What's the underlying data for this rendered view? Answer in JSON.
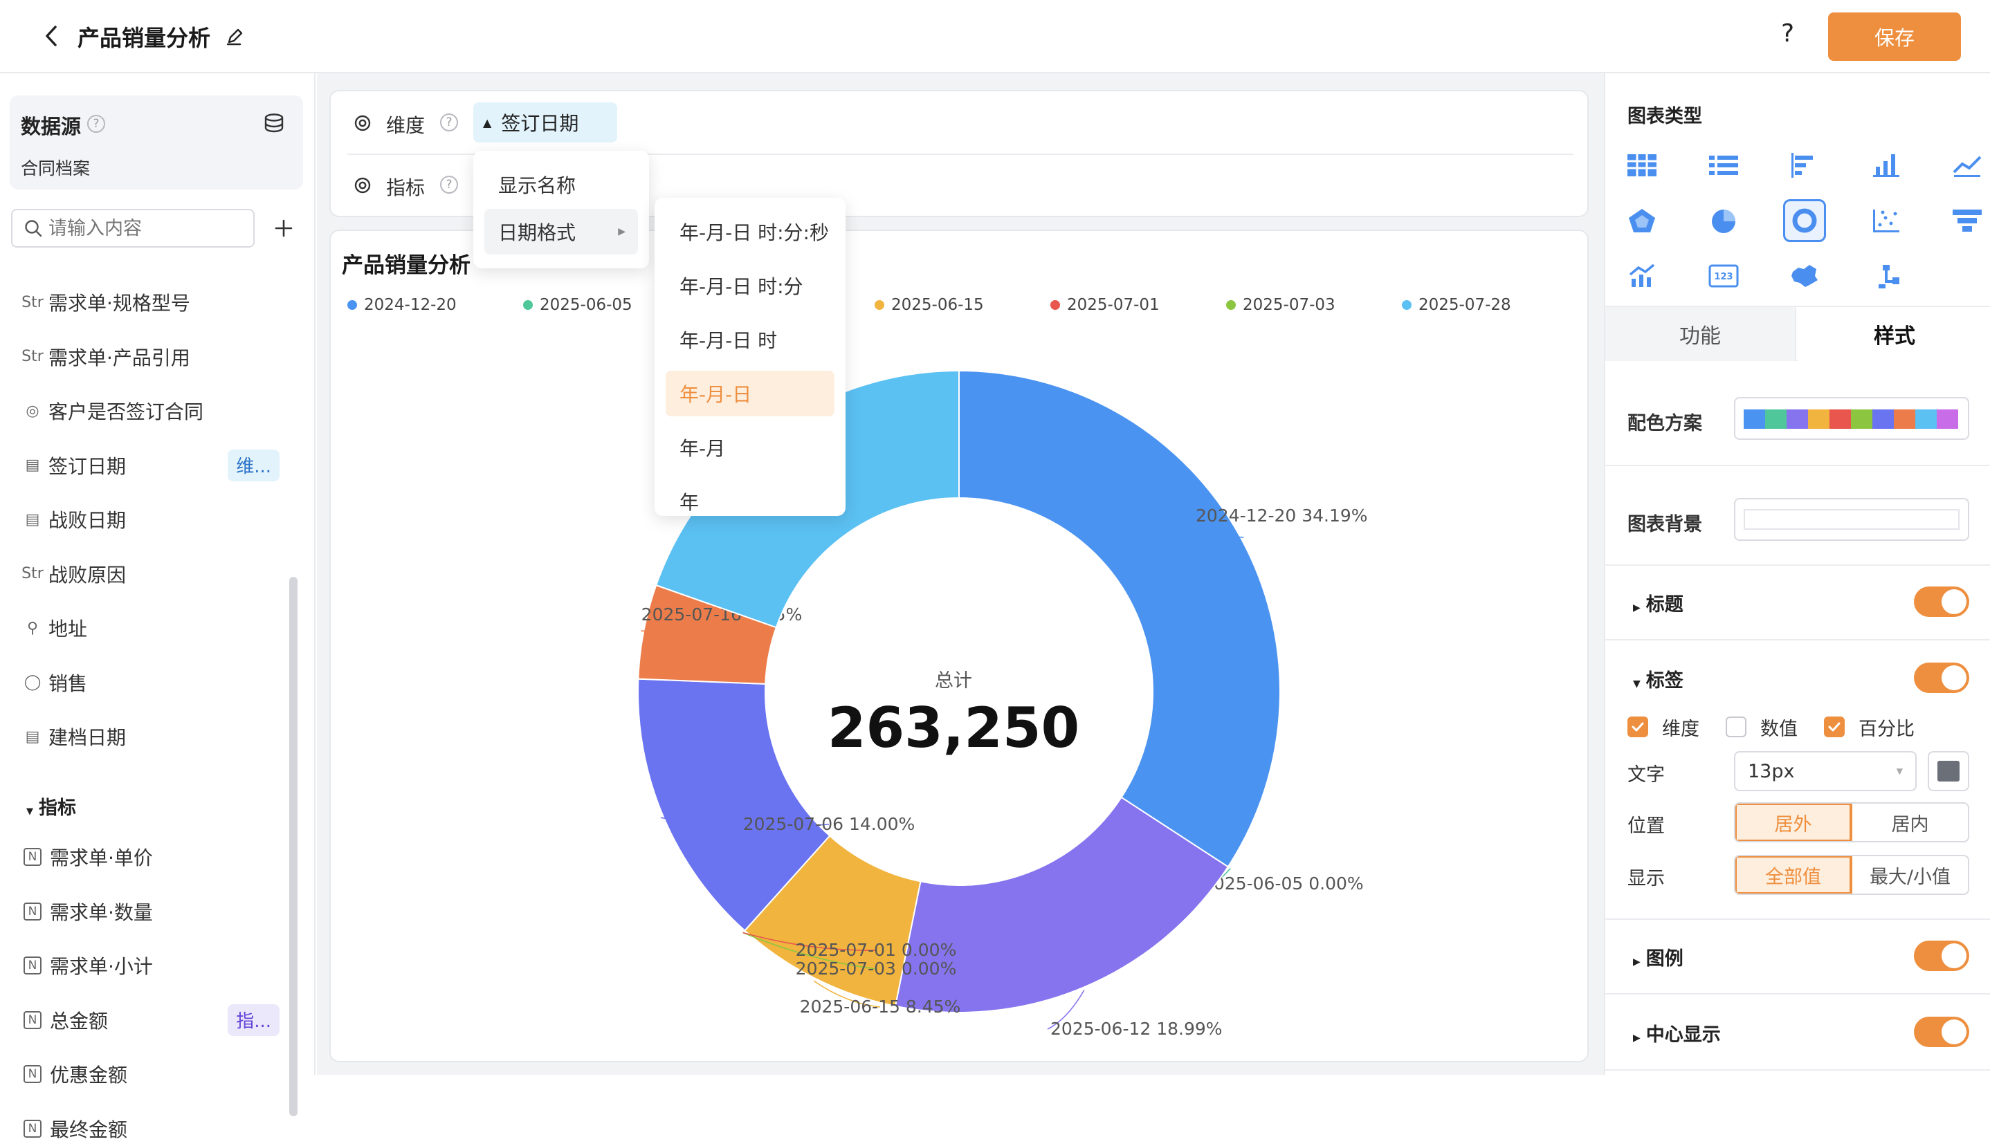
{
  "header": {
    "title": "产品销量分析",
    "help_label": "?",
    "save_label": "保存"
  },
  "datasource": {
    "label": "数据源",
    "name": "合同档案",
    "search_placeholder": "请输入内容",
    "fields": [
      {
        "icon": "Str",
        "label": "需求单·规格型号",
        "badge": ""
      },
      {
        "icon": "Str",
        "label": "需求单·产品引用",
        "badge": ""
      },
      {
        "icon": "◎",
        "label": "客户是否签订合同",
        "badge": ""
      },
      {
        "icon": "▤",
        "label": "签订日期",
        "badge": "维..."
      },
      {
        "icon": "▤",
        "label": "战败日期",
        "badge": ""
      },
      {
        "icon": "Str",
        "label": "战败原因",
        "badge": ""
      },
      {
        "icon": "⚲",
        "label": "地址",
        "badge": ""
      },
      {
        "icon": "◯",
        "label": "销售",
        "badge": ""
      },
      {
        "icon": "▤",
        "label": "建档日期",
        "badge": ""
      }
    ],
    "metrics_group_label": "指标",
    "metrics": [
      {
        "icon": "N",
        "label": "需求单·单价",
        "badge": ""
      },
      {
        "icon": "N",
        "label": "需求单·数量",
        "badge": ""
      },
      {
        "icon": "N",
        "label": "需求单·小计",
        "badge": ""
      },
      {
        "icon": "N",
        "label": "总金额",
        "badge": "指..."
      },
      {
        "icon": "N",
        "label": "优惠金额",
        "badge": ""
      },
      {
        "icon": "N",
        "label": "最终金额",
        "badge": ""
      }
    ]
  },
  "config": {
    "dimension_label": "维度",
    "dimension_chip": "签订日期",
    "metric_label": "指标"
  },
  "dropdown": {
    "items": [
      "显示名称",
      "日期格式"
    ],
    "submenu": [
      "年-月-日 时:分:秒",
      "年-月-日 时:分",
      "年-月-日 时",
      "年-月-日",
      "年-月",
      "年"
    ],
    "selected": "年-月-日"
  },
  "chart_card": {
    "title": "产品销量分析"
  },
  "chart_data": {
    "type": "pie",
    "title": "产品销量分析",
    "center_label": "总计",
    "center_value": "263,250",
    "legend": [
      "2024-12-20",
      "2025-06-05",
      "2025-06-12",
      "2025-06-15",
      "2025-07-01",
      "2025-07-03",
      "2025-07-28"
    ],
    "slices": [
      {
        "name": "2024-12-20",
        "percent": 34.19,
        "color": "#4b93f1",
        "label": "2024-12-20 34.19%"
      },
      {
        "name": "2025-06-05",
        "percent": 0.0,
        "color": "#4fc79a",
        "label": "2025-06-05 0.00%"
      },
      {
        "name": "2025-06-12",
        "percent": 18.99,
        "color": "#8574ee",
        "label": "2025-06-12 18.99%"
      },
      {
        "name": "2025-06-15",
        "percent": 8.45,
        "color": "#f0b43f",
        "label": "2025-06-15 8.45%"
      },
      {
        "name": "2025-07-03",
        "percent": 0.0,
        "color": "#8cc640",
        "label": "2025-07-03 0.00%"
      },
      {
        "name": "2025-07-01",
        "percent": 0.0,
        "color": "#e8564e",
        "label": "2025-07-01 0.00%"
      },
      {
        "name": "2025-07-06",
        "percent": 14.0,
        "color": "#6b74f0",
        "label": "2025-07-06 14.00%"
      },
      {
        "name": "2025-07-16",
        "percent": 4.75,
        "color": "#ec7d4b",
        "label": "2025-07-16 4.75%"
      },
      {
        "name": "2025-07-28",
        "percent": 19.62,
        "color": "#5bc0f2",
        "label": ""
      }
    ]
  },
  "right_panel": {
    "chart_type_label": "图表类型",
    "chart_icons": [
      "table-icon",
      "list-icon",
      "horizontal-bar-icon",
      "bar-chart-icon",
      "line-chart-icon",
      "radar-icon",
      "pie-icon",
      "donut-icon",
      "scatter-icon",
      "funnel-icon",
      "combo-chart-icon",
      "number-card-icon",
      "map-icon",
      "tree-icon"
    ],
    "tab_function": "功能",
    "tab_style": "样式",
    "palette_label": "配色方案",
    "palette": [
      "#4b93f1",
      "#4fc79a",
      "#8574ee",
      "#f0b43f",
      "#e8564e",
      "#8cc640",
      "#6b74f0",
      "#ec7d4b",
      "#5bc0f2",
      "#c86ce8"
    ],
    "background_label": "图表背景",
    "sections": {
      "title": "标题",
      "label": "标签",
      "legend": "图例",
      "center": "中心显示"
    },
    "label_options": {
      "dimension": "维度",
      "value": "数值",
      "percent": "百分比",
      "text_label": "文字",
      "font_size": "13px",
      "position_label": "位置",
      "position_outside": "居外",
      "position_inside": "居内",
      "display_label": "显示",
      "display_all": "全部值",
      "display_minmax": "最大/小值"
    }
  }
}
